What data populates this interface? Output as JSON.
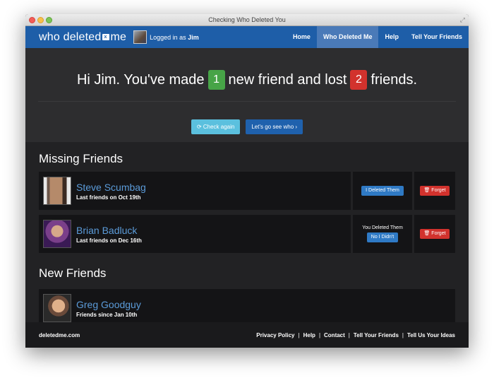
{
  "window": {
    "title": "Checking Who Deleted You"
  },
  "brand": {
    "logo_text_a": "who deleted",
    "logo_mark": "x",
    "logo_text_b": "me"
  },
  "user": {
    "logged_prefix": "Logged in as",
    "name": "Jim"
  },
  "nav": [
    {
      "label": "Home"
    },
    {
      "label": "Who Deleted Me"
    },
    {
      "label": "Help"
    },
    {
      "label": "Tell Your Friends"
    }
  ],
  "hero": {
    "part1": "Hi Jim. You've made",
    "new_count": "1",
    "part2": "new friend and lost",
    "lost_count": "2",
    "part3": "friends.",
    "check_again": "Check again",
    "see_who": "Let's go see who"
  },
  "missing": {
    "title": "Missing Friends",
    "items": [
      {
        "name": "Steve Scumbag",
        "sub": "Last friends on Oct 19th",
        "action": "I Deleted Them",
        "forget": "Forget"
      },
      {
        "name": "Brian Badluck",
        "sub": "Last friends on Dec 16th",
        "action_label": "You Deleted Them",
        "action": "No I Didn't",
        "forget": "Forget"
      }
    ]
  },
  "new_friends": {
    "title": "New Friends",
    "items": [
      {
        "name": "Greg Goodguy",
        "sub": "Friends since Jan 10th"
      }
    ]
  },
  "footer": {
    "site": "deletedme.com",
    "links": [
      "Privacy Policy",
      "Help",
      "Contact",
      "Tell Your Friends",
      "Tell Us Your Ideas"
    ],
    "sep": "|"
  },
  "colors": {
    "nav_bg": "#1e5ea8",
    "green_badge": "#47a447",
    "red_badge": "#d2322d",
    "link": "#5b9bd9"
  }
}
